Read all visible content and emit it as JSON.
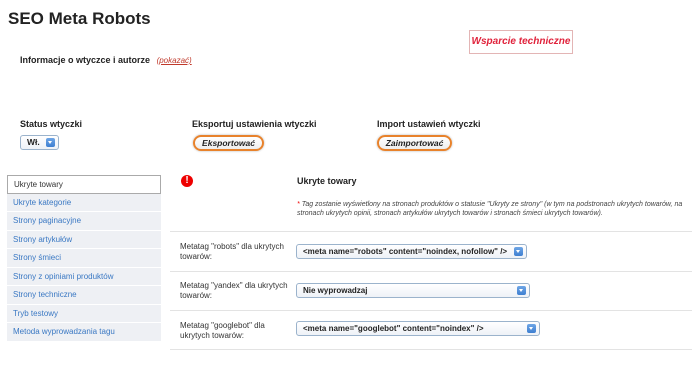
{
  "page": {
    "title": "SEO Meta Robots"
  },
  "support_button": "Wsparcie techniczne",
  "info": {
    "label": "Informacje o wtyczce i autorze",
    "toggle": "(pokazać)"
  },
  "status": {
    "label": "Status wtyczki",
    "value": "Wł."
  },
  "export": {
    "label": "Eksportuj ustawienia wtyczki",
    "button": "Eksportować"
  },
  "import": {
    "label": "Import ustawień wtyczki",
    "button": "Zaimportować"
  },
  "sidebar": {
    "items": [
      {
        "label": "Ukryte towary"
      },
      {
        "label": "Ukryte kategorie"
      },
      {
        "label": "Strony paginacyjne"
      },
      {
        "label": "Strony artykułów"
      },
      {
        "label": "Strony śmieci"
      },
      {
        "label": "Strony z opiniami produktów"
      },
      {
        "label": "Strony techniczne"
      },
      {
        "label": "Tryb testowy"
      },
      {
        "label": "Metoda wyprowadzania tagu"
      }
    ]
  },
  "content": {
    "title": "Ukryte towary",
    "note_star": "*",
    "note": "Tag zostanie wyświetlony na stronach produktów o statusie \"Ukryty ze strony\" (w tym na podstronach ukrytych towarów, na stronach ukrytych opinii, stronach artykułów ukrytych towarów i stronach śmieci ukrytych towarów).",
    "rows": [
      {
        "label": "Metatag \"robots\" dla ukrytych towarów:",
        "value": "<meta name=\"robots\" content=\"noindex, nofollow\" />"
      },
      {
        "label": "Metatag \"yandex\" dla ukrytych towarów:",
        "value": "Nie wyprowadzaj"
      },
      {
        "label": "Metatag \"googlebot\" dla ukrytych towarów:",
        "value": "<meta name=\"googlebot\" content=\"noindex\" />"
      }
    ]
  }
}
